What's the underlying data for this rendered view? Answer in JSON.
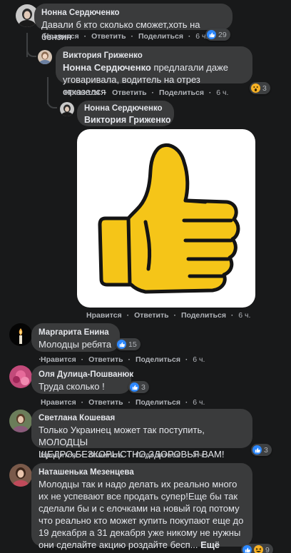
{
  "actions": {
    "like": "Нравится",
    "reply": "Ответить",
    "share": "Поделиться",
    "sep": "·"
  },
  "comments": [
    {
      "author": "Нонна Сердюченко",
      "text": "Давали б кто сколько сможет,хоть на бензин",
      "time": "6 ч.",
      "reactions": "29"
    },
    {
      "author": "Виктория Гриженко",
      "mention": "Нонна Сердюченко",
      "text": " предлагали даже уговаривала, водитель на отрез отказался",
      "time": "6 ч.",
      "reactions": "3"
    },
    {
      "author": "Нонна Сердюченко",
      "mention": "Виктория Гриженко",
      "time": "6 ч.",
      "sticker": "thumbs-up-sticker"
    },
    {
      "author": "Маргарита Енина",
      "text": "Молодцы ребята .",
      "time": "6 ч.",
      "reactions": "15"
    },
    {
      "author": "Оля Дулица-Пошванюк",
      "text": "Труда сколько !",
      "time": "6 ч.",
      "reactions": "3"
    },
    {
      "author": "Светлана Кошевая",
      "text": "Только Украинец может так поступить, МОЛОДЦЫ ЩЕДРО,БЕЗКОРЫСТНО,ЗДОРОВЬЯ ВАМ!",
      "time": "4 ч.",
      "reactions": "3"
    },
    {
      "author": "Наташенька Мезенцева",
      "text": "Молодцы так и надо делать их реально много их не успевают все продать супер!Еще бы так сделали бы и с елочками на новый год потому что реально кто может купить покупают еще до 19 декабря а 31 декабря уже никому не нужны они сделайте акцию роздайте бесп...",
      "more": "Ещё",
      "reactions": "9"
    }
  ],
  "colors": {
    "background": "#18191a",
    "bubble": "#3a3b3c",
    "like": "#2d88ff",
    "wow": "#f7b125",
    "sticker_yellow": "#f5c518"
  }
}
